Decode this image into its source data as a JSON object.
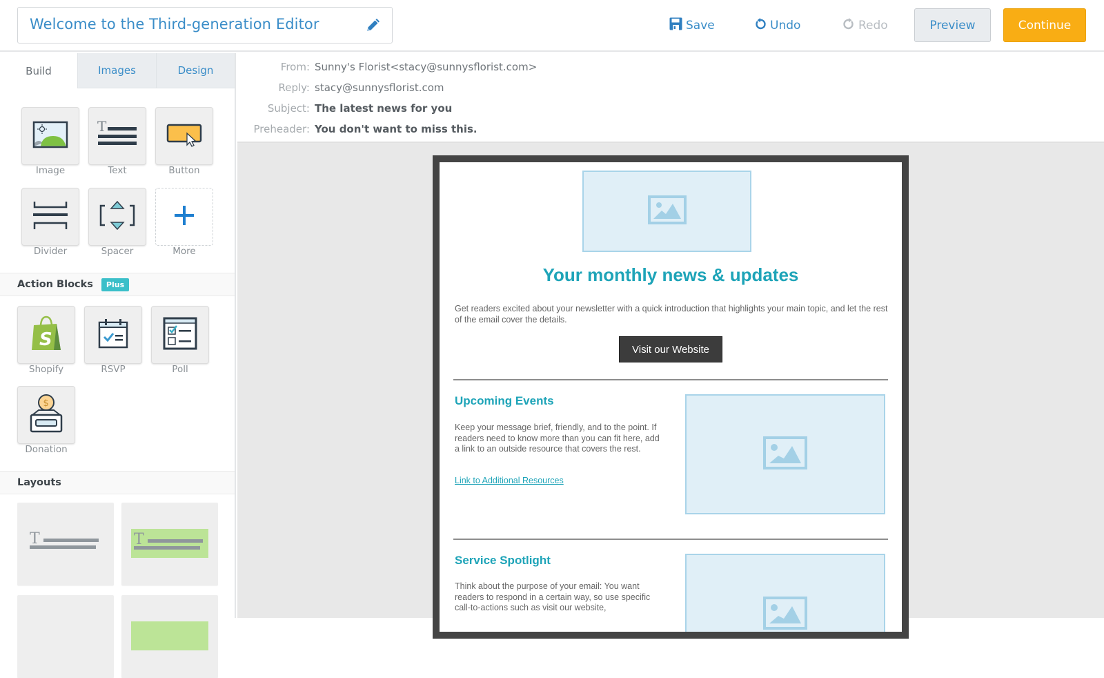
{
  "header": {
    "title": "Welcome to the Third-generation Editor",
    "edit_icon": "pencil-icon",
    "save_label": "Save",
    "undo_label": "Undo",
    "redo_label": "Redo",
    "preview_label": "Preview",
    "continue_label": "Continue"
  },
  "sidebar": {
    "tabs": [
      {
        "label": "Build",
        "active": true
      },
      {
        "label": "Images",
        "active": false
      },
      {
        "label": "Design",
        "active": false
      }
    ],
    "blocks": [
      {
        "label": "Image",
        "icon": "image-block-icon"
      },
      {
        "label": "Text",
        "icon": "text-block-icon"
      },
      {
        "label": "Button",
        "icon": "button-block-icon"
      },
      {
        "label": "Divider",
        "icon": "divider-block-icon"
      },
      {
        "label": "Spacer",
        "icon": "spacer-block-icon"
      },
      {
        "label": "More",
        "icon": "plus-icon"
      }
    ],
    "action_blocks": {
      "title": "Action Blocks",
      "badge": "Plus",
      "items": [
        {
          "label": "Shopify",
          "icon": "shopify-icon"
        },
        {
          "label": "RSVP",
          "icon": "calendar-check-icon"
        },
        {
          "label": "Poll",
          "icon": "poll-icon"
        },
        {
          "label": "Donation",
          "icon": "donation-box-icon"
        }
      ]
    },
    "layouts": {
      "title": "Layouts"
    }
  },
  "email_headers": {
    "from_label": "From:",
    "from_value": "Sunny's Florist<stacy@sunnysflorist.com>",
    "reply_label": "Reply:",
    "reply_value": "stacy@sunnysflorist.com",
    "subject_label": "Subject:",
    "subject_value": "The latest news for you",
    "preheader_label": "Preheader:",
    "preheader_value": "You don't want to miss this."
  },
  "email": {
    "headline": "Your monthly news & updates",
    "intro": "Get readers excited about your newsletter with a quick introduction that highlights your main topic, and let the rest of the email cover the details.",
    "cta_label": "Visit our Website",
    "sections": [
      {
        "title": "Upcoming Events",
        "body": "Keep your message brief, friendly, and to the point. If readers need to know more than you can fit here, add a link to an outside resource that covers the rest.",
        "link": "Link to Additional Resources"
      },
      {
        "title": "Service Spotlight",
        "body": "Think about the purpose of your email: You want readers to respond in a certain way, so use specific call-to-actions such as visit our website,"
      }
    ]
  },
  "colors": {
    "accent_blue": "#3a8dc8",
    "continue_orange": "#f9ad14",
    "email_teal": "#1ea4b8",
    "plus_badge": "#3bbfc9"
  }
}
